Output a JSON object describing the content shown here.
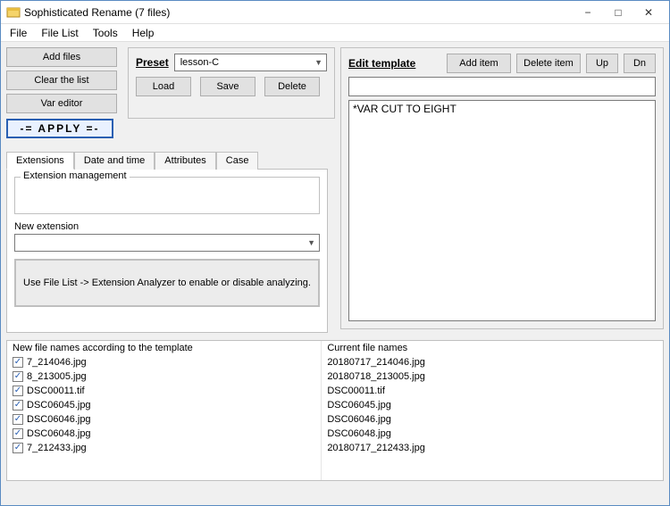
{
  "title": "Sophisticated Rename (7 files)",
  "menu": {
    "file": "File",
    "filelist": "File List",
    "tools": "Tools",
    "help": "Help"
  },
  "sidebuttons": {
    "add": "Add files",
    "clear": "Clear the list",
    "vareditor": "Var editor"
  },
  "preset": {
    "label": "Preset",
    "value": "lesson-C",
    "load": "Load",
    "save": "Save",
    "delete": "Delete"
  },
  "apply_label": "-= APPLY =-",
  "edit": {
    "label": "Edit template",
    "additem": "Add item",
    "deleteitem": "Delete item",
    "up": "Up",
    "dn": "Dn",
    "template_input": "",
    "template_item": "*VAR CUT TO EIGHT"
  },
  "tabs": {
    "extensions": "Extensions",
    "datetime": "Date and time",
    "attributes": "Attributes",
    "case": "Case"
  },
  "ext": {
    "mgmt_label": "Extension management",
    "newext_label": "New extension",
    "newext_value": "",
    "hint": "Use File List -> Extension Analyzer to enable or disable analyzing."
  },
  "files": {
    "new_header": "New file names according to the template",
    "cur_header": "Current file names",
    "rows": [
      {
        "new": "7_214046.jpg",
        "cur": "20180717_214046.jpg"
      },
      {
        "new": "8_213005.jpg",
        "cur": "20180718_213005.jpg"
      },
      {
        "new": "DSC00011.tif",
        "cur": "DSC00011.tif"
      },
      {
        "new": "DSC06045.jpg",
        "cur": "DSC06045.jpg"
      },
      {
        "new": "DSC06046.jpg",
        "cur": "DSC06046.jpg"
      },
      {
        "new": "DSC06048.jpg",
        "cur": "DSC06048.jpg"
      },
      {
        "new": "7_212433.jpg",
        "cur": "20180717_212433.jpg"
      }
    ]
  }
}
